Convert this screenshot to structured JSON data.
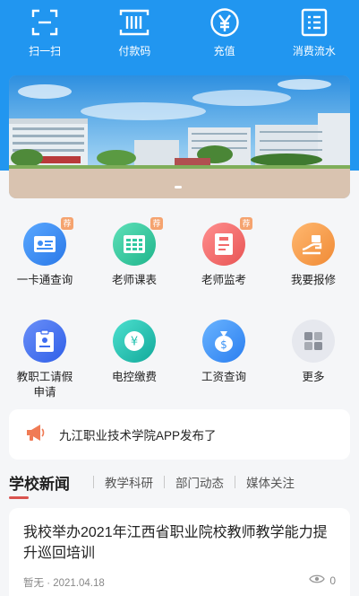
{
  "quick_actions": [
    {
      "label": "扫一扫",
      "icon": "scan-icon"
    },
    {
      "label": "付款码",
      "icon": "barcode-icon"
    },
    {
      "label": "充值",
      "icon": "yuan-circle-icon"
    },
    {
      "label": "消费流水",
      "icon": "list-icon"
    }
  ],
  "banner": {
    "page_indicator_count": 1
  },
  "services": [
    {
      "label": "一卡通查询",
      "icon": "id-card-icon",
      "badge": "荐",
      "color": "#3d8ef5"
    },
    {
      "label": "老师课表",
      "icon": "schedule-icon",
      "badge": "荐",
      "color": "#2fc8a0"
    },
    {
      "label": "老师监考",
      "icon": "exam-icon",
      "badge": "荐",
      "color": "#f26b6b"
    },
    {
      "label": "我要报修",
      "icon": "repair-icon",
      "badge": "",
      "color": "#f59a45"
    },
    {
      "label": "教职工请假申请",
      "icon": "leave-request-icon",
      "badge": "",
      "color": "#3d6cf0"
    },
    {
      "label": "电控缴费",
      "icon": "electric-payment-icon",
      "badge": "",
      "color": "#22c1b0"
    },
    {
      "label": "工资查询",
      "icon": "salary-icon",
      "badge": "",
      "color": "#3f95f5"
    },
    {
      "label": "更多",
      "icon": "more-icon",
      "badge": "",
      "color": "#8a8f99"
    }
  ],
  "notice": {
    "text": "九江职业技术学院APP发布了",
    "icon": "megaphone-icon"
  },
  "news_tabs": {
    "active": "学校新闻",
    "others": [
      "教学科研",
      "部门动态",
      "媒体关注"
    ]
  },
  "news": {
    "title": "我校举办2021年江西省职业院校教师教学能力提升巡回培训",
    "author": "暂无",
    "date": "2021.04.18",
    "views": "0"
  },
  "colors": {
    "brand": "#2196f0",
    "badge": "#f5a36f",
    "tab_underline": "#d9534f"
  }
}
